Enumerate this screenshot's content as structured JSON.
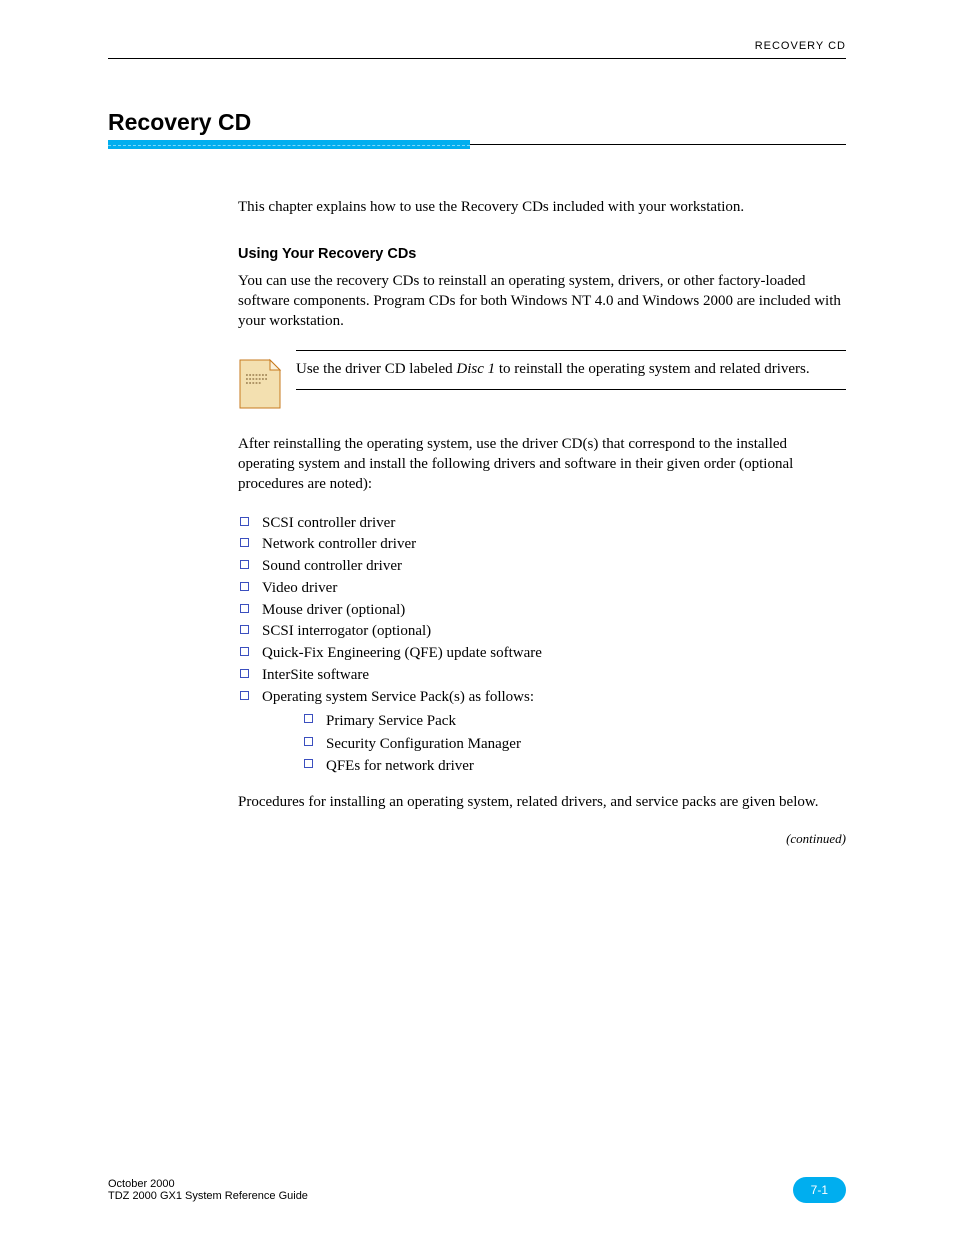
{
  "header": {
    "breadcrumb": "RECOVERY CD"
  },
  "title": "Recovery CD",
  "intro": {
    "p1": "This chapter explains how to use the Recovery CDs included with your workstation.",
    "subhead": "Using Your Recovery CDs",
    "p2": "You can use the recovery CDs to reinstall an operating system, drivers, or other factory-loaded software components. Program CDs for both Windows NT 4.0 and Windows 2000 are included with your workstation."
  },
  "note": {
    "text_prefix": "Use the driver CD labeled ",
    "text_em": "Disc 1",
    "text_suffix": " to reinstall the operating system and related drivers."
  },
  "p3": "After reinstalling the operating system, use the driver CD(s) that correspond to the installed operating system and install the following drivers and software in their given order (optional procedures are noted):",
  "bullets": [
    "SCSI controller driver",
    "Network controller driver",
    "Sound controller driver",
    "Video driver",
    "Mouse driver (optional)",
    "SCSI interrogator (optional)",
    "Quick-Fix Engineering (QFE) update software",
    "InterSite software",
    "Operating system Service Pack(s) as follows:"
  ],
  "sub_bullets": [
    "Primary Service Pack",
    "Security Configuration Manager",
    "QFEs for network driver"
  ],
  "p4": "Procedures for installing an operating system, related drivers, and service packs are given below.",
  "continued": "(continued)",
  "footer": {
    "date": "October 2000",
    "guide": "TDZ 2000 GX1 System Reference Guide",
    "page": "7-1"
  }
}
